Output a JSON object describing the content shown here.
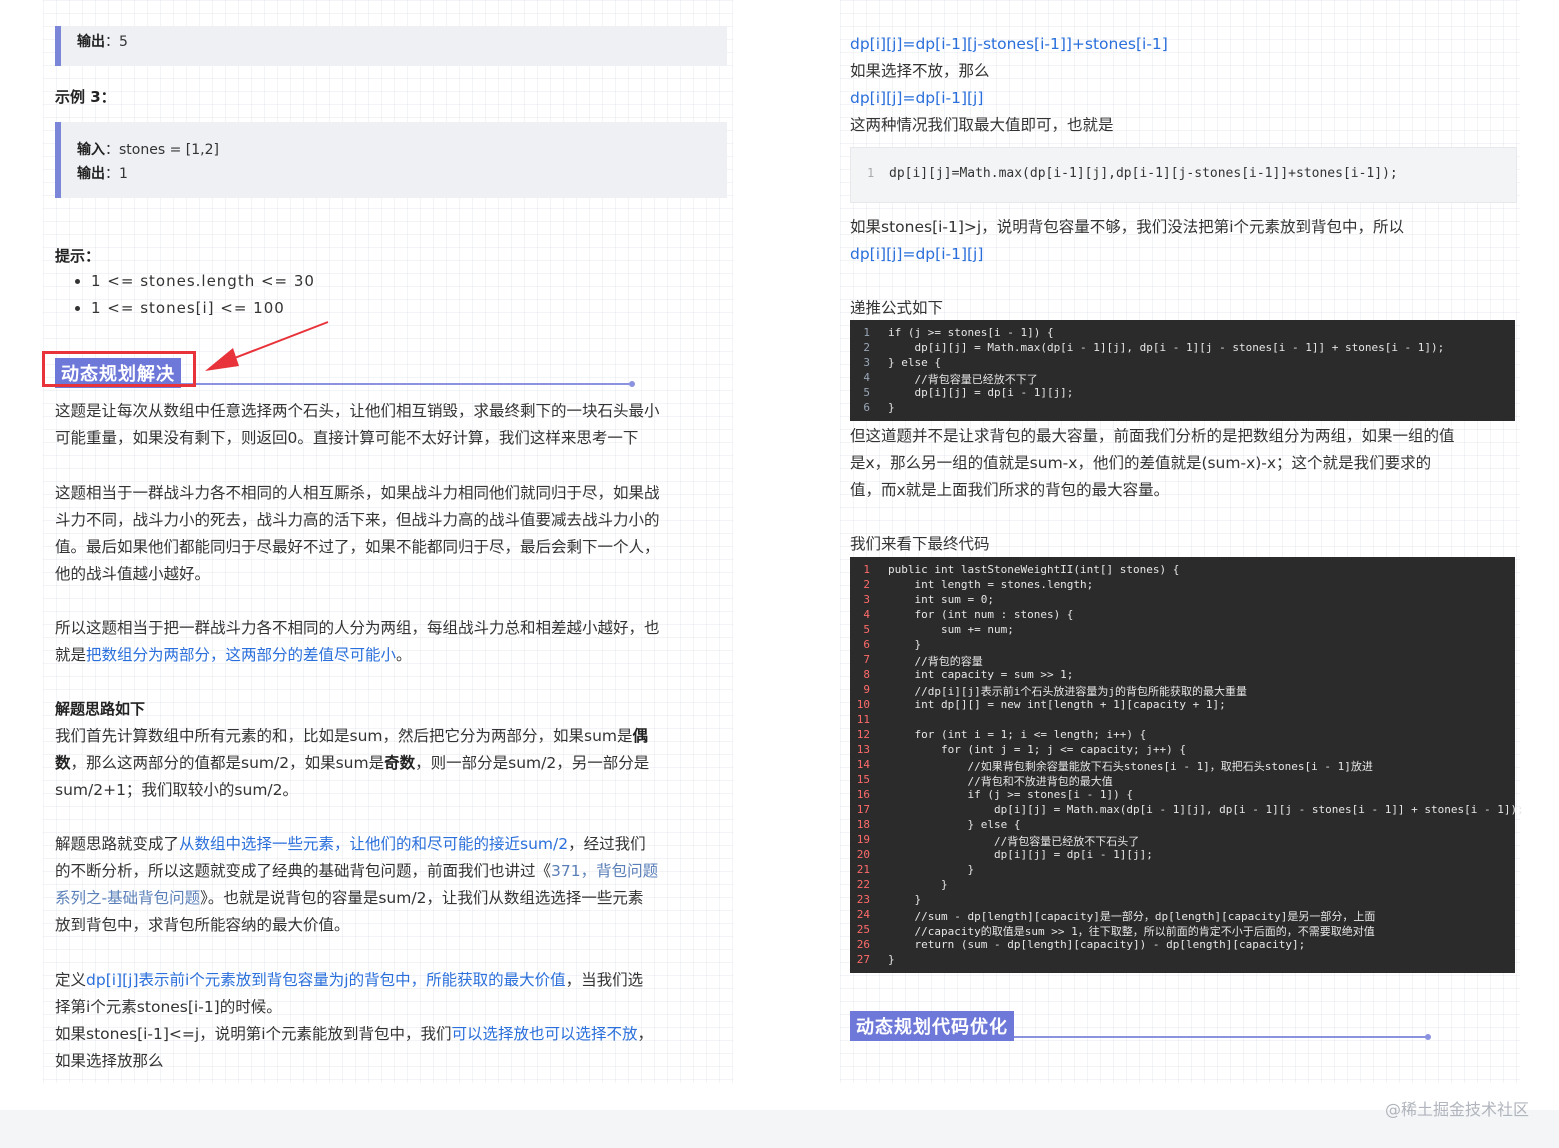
{
  "left": {
    "example2_output_label": "输出",
    "example2_output_value": "：5",
    "example3_heading": "示例 3：",
    "example3_input_label": "输入",
    "example3_input_value": "：stones = [1,2]",
    "example3_output_label": "输出",
    "example3_output_value": "：1",
    "tips_heading": "提示：",
    "tips": [
      "1 <= stones.length <= 30",
      "1 <= stones[i] <= 100"
    ],
    "section_heading": "动态规划解决",
    "p1_l1": "这题是让每次从数组中任意选择两个石头，让他们相互销毁，求最终剩下的一块石头最小",
    "p1_l2": "可能重量，如果没有剩下，则返回0。直接计算可能不太好计算，我们这样来思考一下",
    "p2_l1": "这题相当于一群战斗力各不相同的人相互厮杀，如果战斗力相同他们就同归于尽，如果战",
    "p2_l2": "斗力不同，战斗力小的死去，战斗力高的活下来，但战斗力高的战斗值要减去战斗力小的",
    "p2_l3": "值。最后如果他们都能同归于尽最好不过了，如果不能都同归于尽，最后会剩下一个人，",
    "p2_l4": "他的战斗值越小越好。",
    "p3_l1": "所以这题相当于把一群战斗力各不相同的人分为两组，每组战斗力总和相差越小越好，也",
    "p3_l2a": "就是",
    "p3_l2b": "把数组分为两部分，这两部分的差值尽可能小",
    "p3_l2c": "。",
    "idea_heading": "解题思路如下",
    "p4_l1a": "我们首先计算数组中所有元素的和，比如是sum，然后把它分为两部分，如果sum是",
    "p4_l1b": "偶",
    "p4_l2a": "数",
    "p4_l2b": "，那么这两部分的值都是sum/2，如果sum是",
    "p4_l2c": "奇数",
    "p4_l2d": "，则一部分是sum/2，另一部分是",
    "p4_l3": "sum/2+1；我们取较小的sum/2。",
    "p5_l1a": "解题思路就变成了",
    "p5_l1b": "从数组中选择一些元素，让他们的和尽可能的接近sum/2",
    "p5_l1c": "，经过我们",
    "p5_l2a": "的不断分析，所以这题就变成了经典的基础背包问题，前面我们也讲过《",
    "p5_l2b": "371，背包问题",
    "p5_l3a": "系列之-基础背包问题",
    "p5_l3b": "》。也就是说背包的容量是sum/2，让我们从数组选选择一些元素",
    "p5_l4": "放到背包中，求背包所能容纳的最大价值。",
    "p6_l1a": "定义",
    "p6_l1b": "dp[i][j]表示前i个元素放到背包容量为j的背包中，所能获取的最大价值",
    "p6_l1c": "，当我们选",
    "p6_l2": "择第i个元素stones[i-1]的时候。",
    "p6_l3a": "如果stones[i-1]<=j，说明第i个元素能放到背包中，我们",
    "p6_l3b": "可以选择放也可以选择不放",
    "p6_l3c": "，",
    "p6_l4": "如果选择放那么"
  },
  "right": {
    "r1": "dp[i][j]=dp[i-1][j-stones[i-1]]+stones[i-1]",
    "r2": "如果选择不放，那么",
    "r3": "dp[i][j]=dp[i-1][j]",
    "r4": "这两种情况我们取最大值即可，也就是",
    "code1_ln": "1",
    "code1": "dp[i][j]=Math.max(dp[i-1][j],dp[i-1][j-stones[i-1]]+stones[i-1]);",
    "r5": "如果stones[i-1]>j，说明背包容量不够，我们没法把第i个元素放到背包中，所以",
    "r6": "dp[i][j]=dp[i-1][j]",
    "r7": "递推公式如下",
    "code2": [
      "if (j >= stones[i - 1]) {",
      "    dp[i][j] = Math.max(dp[i - 1][j], dp[i - 1][j - stones[i - 1]] + stones[i - 1]);",
      "} else {",
      "    //背包容量已经放不下了",
      "    dp[i][j] = dp[i - 1][j];",
      "}"
    ],
    "r8_l1": "但这道题并不是让求背包的最大容量，前面我们分析的是把数组分为两组，如果一组的值",
    "r8_l2": "是x，那么另一组的值就是sum-x，他们的差值就是(sum-x)-x；这个就是我们要求的",
    "r8_l3": "值，而x就是上面我们所求的背包的最大容量。",
    "r9": "我们来看下最终代码",
    "code3": [
      "public int lastStoneWeightII(int[] stones) {",
      "    int length = stones.length;",
      "    int sum = 0;",
      "    for (int num : stones) {",
      "        sum += num;",
      "    }",
      "    //背包的容量",
      "    int capacity = sum >> 1;",
      "    //dp[i][j]表示前i个石头放进容量为j的背包所能获取的最大重量",
      "    int dp[][] = new int[length + 1][capacity + 1];",
      "",
      "    for (int i = 1; i <= length; i++) {",
      "        for (int j = 1; j <= capacity; j++) {",
      "            //如果背包剩余容量能放下石头stones[i - 1]，取把石头stones[i - 1]放进",
      "            //背包和不放进背包的最大值",
      "            if (j >= stones[i - 1]) {",
      "                dp[i][j] = Math.max(dp[i - 1][j], dp[i - 1][j - stones[i - 1]] + stones[i - 1]);",
      "            } else {",
      "                //背包容量已经放不下石头了",
      "                dp[i][j] = dp[i - 1][j];",
      "            }",
      "        }",
      "    }",
      "    //sum - dp[length][capacity]是一部分，dp[length][capacity]是另一部分，上面",
      "    //capacity的取值是sum >> 1，往下取整，所以前面的肯定不小于后面的，不需要取绝对值",
      "    return (sum - dp[length][capacity]) - dp[length][capacity];",
      "}"
    ],
    "section2_heading": "动态规划代码优化"
  },
  "watermark": "@稀土掘金技术社区",
  "colors": {
    "accent": "#6e78d8",
    "link_blue": "#2a6fdb",
    "highlight_red": "#e8333a",
    "code_bg": "#2b2b2b"
  }
}
